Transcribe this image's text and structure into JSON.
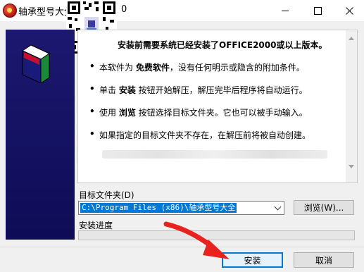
{
  "window": {
    "title": "轴承型号大全",
    "title_suffix": "0"
  },
  "info": {
    "header": "安装前需要系统已经安装了OFFICE2000或以上版本。",
    "bullets": [
      {
        "pre": "本软件为 ",
        "em": "免费软件",
        "post": "，没有任何明示或隐含的附加条件。"
      },
      {
        "pre": "单击 ",
        "em": "安装",
        "post": " 按钮开始解压，解压完毕后程序将自动运行。"
      },
      {
        "pre": "使用 ",
        "em": "浏览",
        "post": " 按钮选择目标文件夹。它也可以被手动输入。"
      },
      {
        "pre": "",
        "em": "",
        "post": "如果指定的目标文件夹不存在，在解压前将被自动创建。"
      }
    ]
  },
  "target": {
    "label": "目标文件夹(D)",
    "path": "C:\\Program Files (x86)\\轴承型号大全",
    "browse_label": "浏览(W)..."
  },
  "progress": {
    "label": "安装进度",
    "value": 0
  },
  "buttons": {
    "install": "安装",
    "cancel": "取消"
  },
  "colors": {
    "banner": "#1c1870",
    "accent": "#0078d7",
    "arrow": "#e8231f"
  }
}
